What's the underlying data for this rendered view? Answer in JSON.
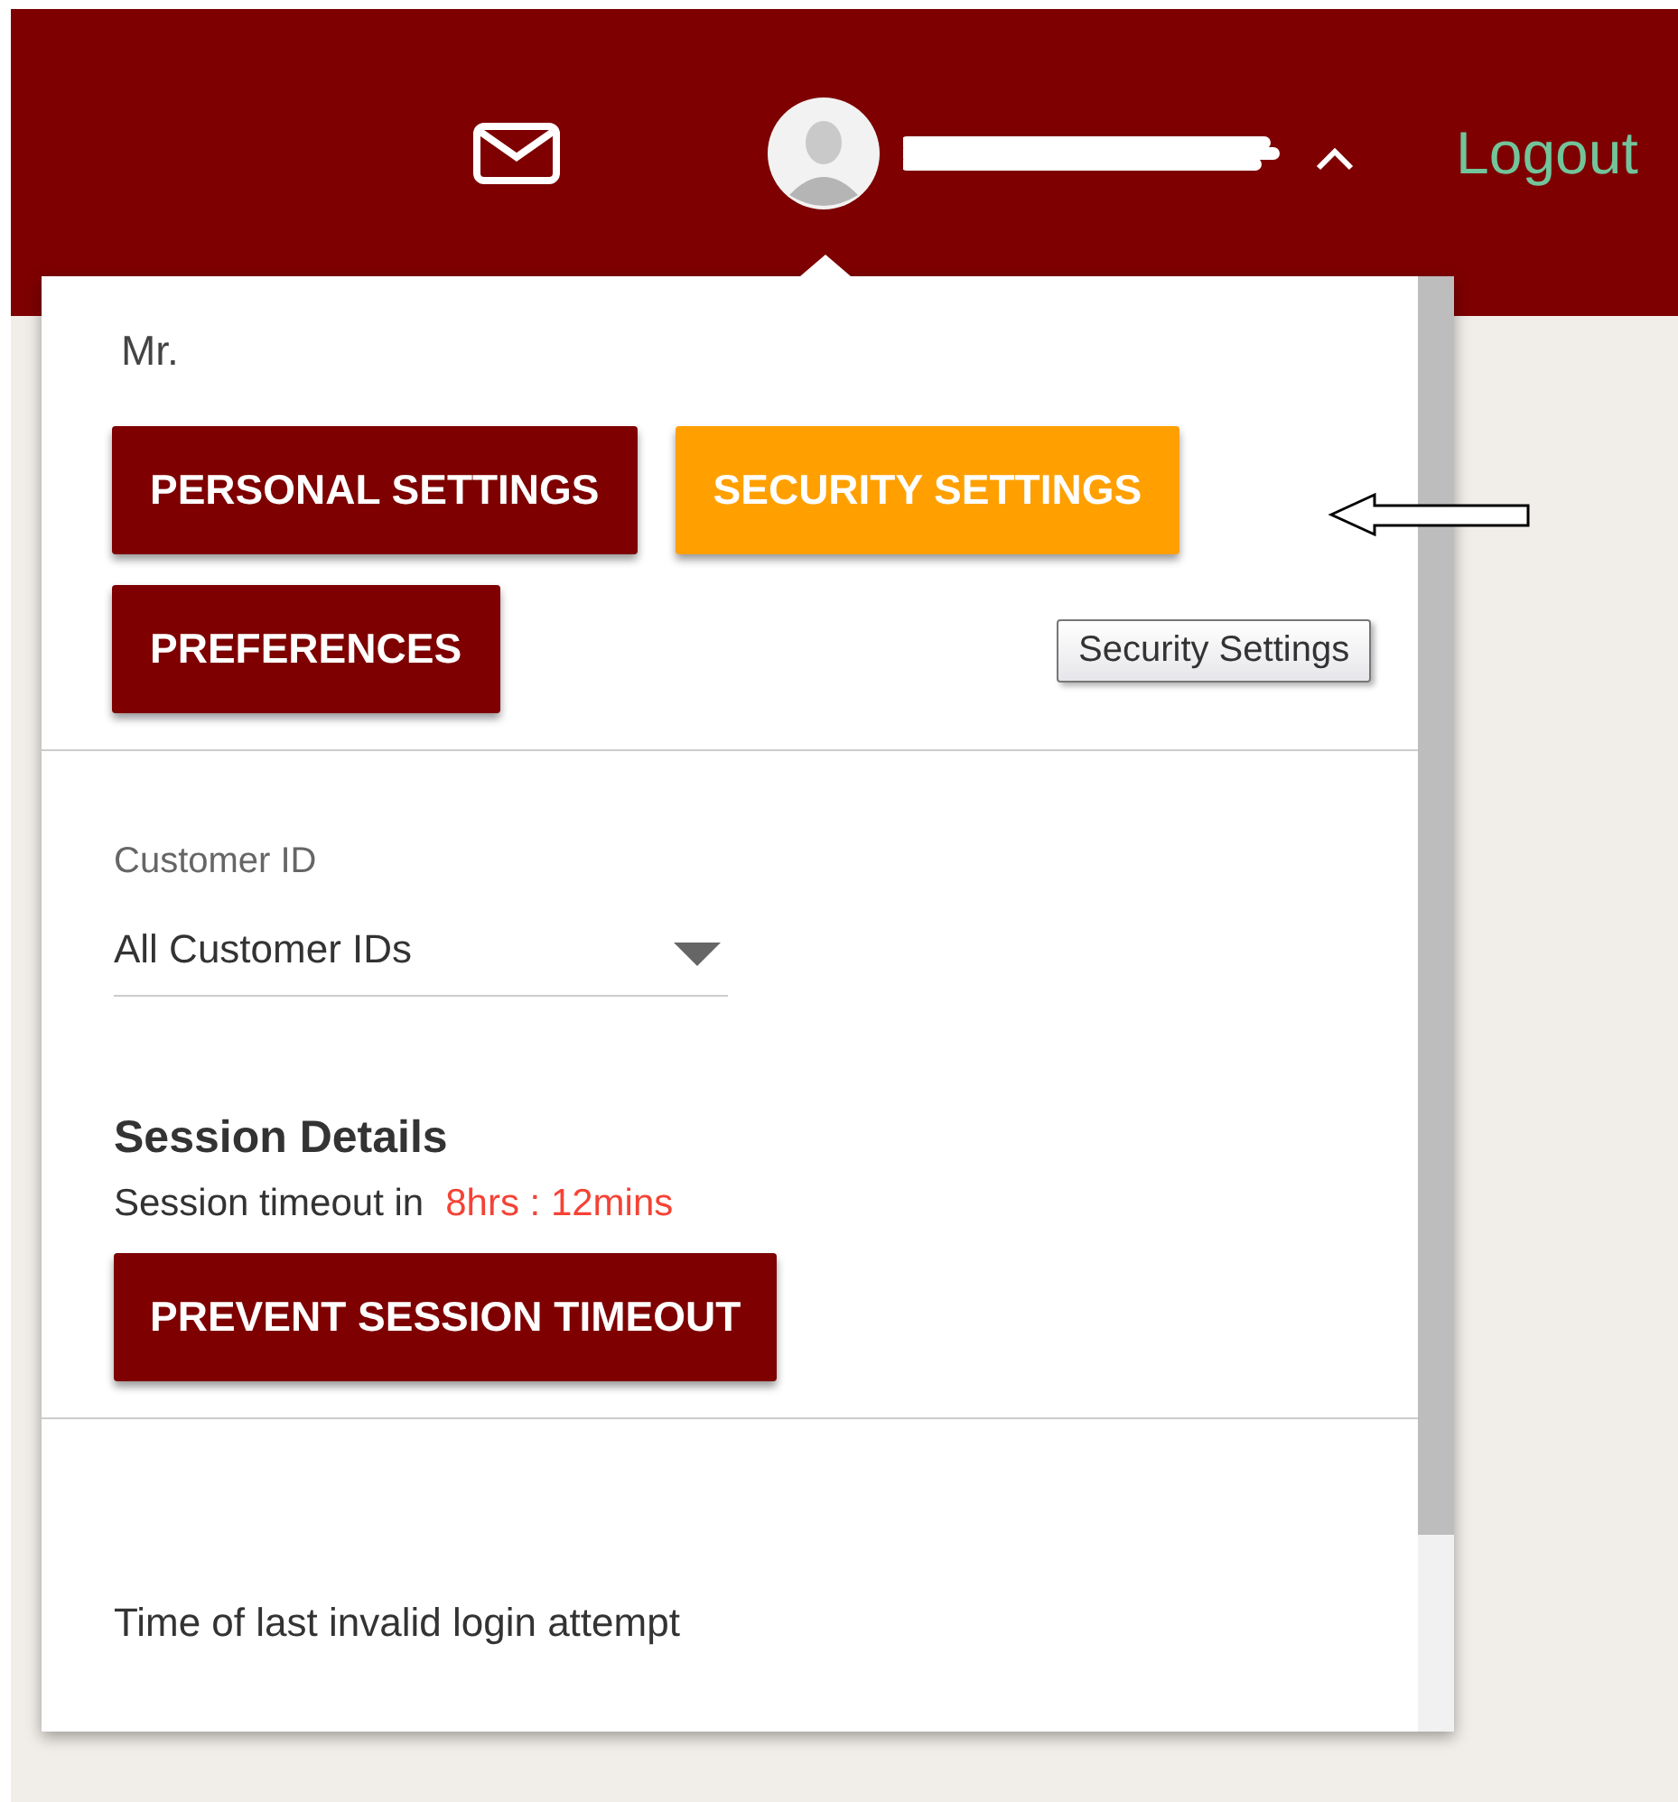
{
  "header": {
    "logout": "Logout",
    "menu_expanded": true
  },
  "user_menu": {
    "greeting": "Mr.",
    "buttons": [
      {
        "label": "PERSONAL SETTINGS",
        "selected": false
      },
      {
        "label": "SECURITY SETTINGS",
        "selected": true
      },
      {
        "label": "PREFERENCES",
        "selected": false
      }
    ],
    "tooltip": "Security Settings",
    "customer_id": {
      "label": "Customer ID",
      "value": "All Customer IDs"
    },
    "session": {
      "title": "Session Details",
      "timeout_label": "Session timeout in",
      "timeout_value": "8hrs : 12mins",
      "button": "PREVENT SESSION TIMEOUT"
    },
    "last_invalid_login": {
      "label": "Time of last invalid login attempt"
    }
  }
}
